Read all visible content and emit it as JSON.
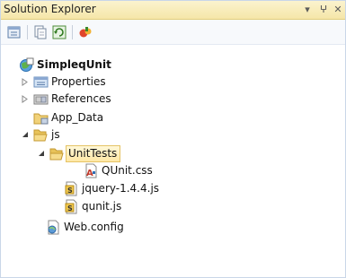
{
  "window": {
    "title": "Solution Explorer",
    "buttons": {
      "dropdown": "▾",
      "pin": "ⵖ",
      "close": "✕"
    }
  },
  "toolbar": {
    "tools": [
      "properties-icon",
      "show-all-files-icon",
      "refresh-icon",
      "view-class-diagram-icon"
    ]
  },
  "tree": {
    "items": [
      {
        "label": "SimpleqUnit",
        "icon": "web-project-icon",
        "expanded": true,
        "level": 0
      },
      {
        "label": "Properties",
        "icon": "properties-folder-icon",
        "expanded": false,
        "level": 1
      },
      {
        "label": "References",
        "icon": "references-folder-icon",
        "expanded": false,
        "level": 1
      },
      {
        "label": "App_Data",
        "icon": "folder-icon",
        "level": 1
      },
      {
        "label": "js",
        "icon": "folder-open-icon",
        "expanded": true,
        "level": 1
      },
      {
        "label": "UnitTests",
        "icon": "folder-open-icon",
        "expanded": true,
        "selected": true,
        "level": 2
      },
      {
        "label": "QUnit.css",
        "icon": "css-file-icon",
        "level": 3
      },
      {
        "label": "jquery-1.4.4.js",
        "icon": "js-file-icon",
        "level": 2
      },
      {
        "label": "qunit.js",
        "icon": "js-file-icon",
        "level": 2
      },
      {
        "label": "Web.config",
        "icon": "config-file-icon",
        "level": 1
      }
    ]
  },
  "colors": {
    "titlebar": "#f5e6a8",
    "selection": "#ffe8a6",
    "border": "#c9d6e8"
  }
}
